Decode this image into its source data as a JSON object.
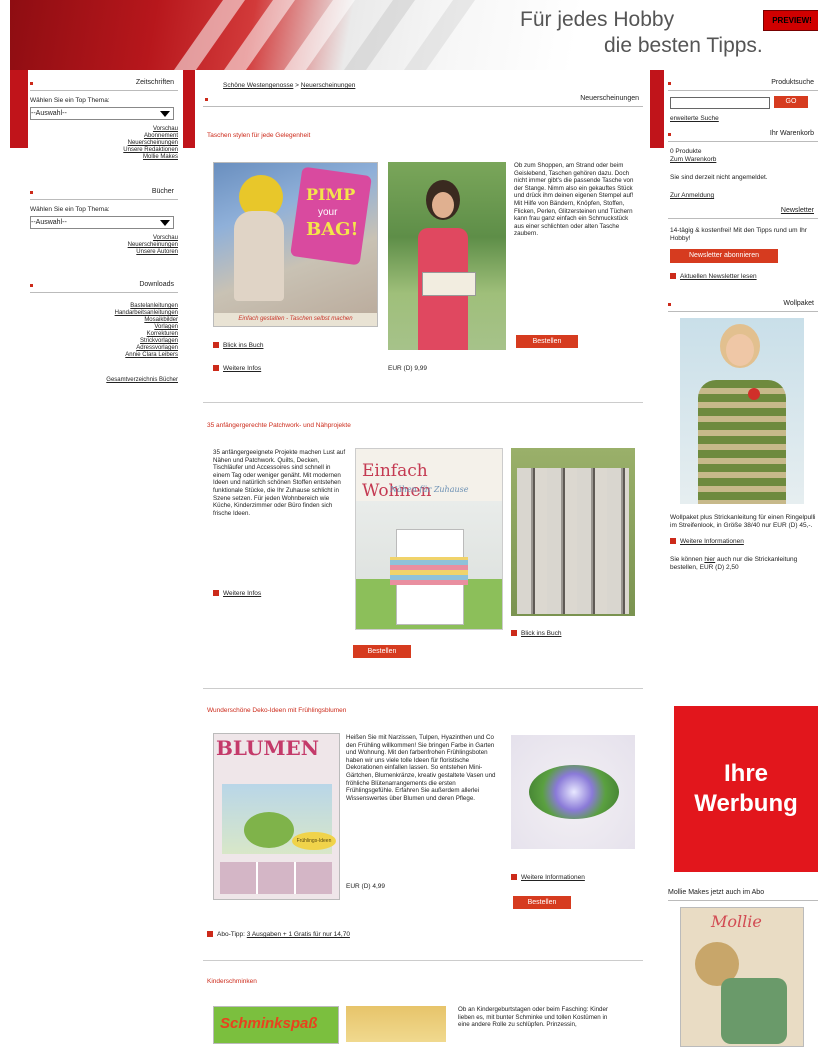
{
  "header": {
    "tagline_1": "Für jedes Hobby",
    "tagline_2": "die besten Tipps.",
    "preview_label": "PREVIEW!"
  },
  "left": {
    "zeitschriften": {
      "title": "Zeitschriften",
      "prompt": "Wählen Sie ein Top Thema:",
      "select_value": "--Auswahl--",
      "links": [
        "Vorschau",
        "Abonnement",
        "Neuerscheinungen",
        "Unsere Redaktionen",
        "Mollie Makes"
      ]
    },
    "buecher": {
      "title": "Bücher",
      "prompt": "Wählen Sie ein Top Thema:",
      "select_value": "--Auswahl--",
      "links": [
        "Vorschau",
        "Neuerscheinungen",
        "Unsere Autoren"
      ]
    },
    "downloads": {
      "title": "Downloads",
      "links": [
        "Bastelanleitungen",
        "Handarbeitsanleitungen",
        "Mosaikbilder",
        "Vorlagen",
        "Korrekturen",
        "Strickvorlagen",
        "Adressvorlagen",
        "Annie Clara Leibers"
      ],
      "extra": "Gesamtverzeichnis Bücher"
    }
  },
  "main": {
    "breadcrumb": [
      "Schöne Westengenosse",
      "Neuerscheinungen"
    ],
    "section_title": "Neuerscheinungen",
    "article1": {
      "headline": "Taschen stylen für jede Gelegenheit",
      "cover_text_1": "PIMP",
      "cover_text_2": "your",
      "cover_text_3": "BAG!",
      "cover_subtitle": "Einfach gestalten - Taschen selbst machen",
      "body": "Ob zum Shoppen, am Strand oder beim Geislebend, Taschen gehören dazu. Doch nicht immer gibt's die passende Tasche von der Stange. Nimm also ein gekauftes Stück und drück ihm deinen eigenen Stempel auf! Mit Hilfe von Bändern, Knöpfen, Stoffen, Flicken, Perlen, Glitzersteinen und Tüchern kann frau ganz einfach ein Schmuckstück aus einer schlichten oder alten Tasche zaubern.",
      "link_blick": "Blick ins Buch",
      "link_info": "Weitere Infos",
      "price": "EUR (D) 9,99",
      "button": "Bestellen"
    },
    "article2": {
      "headline": "35 anfängergerechte Patchwork- und Nähprojekte",
      "body": "35 anfängergeeignete Projekte machen Lust auf Nähen und Patchwork. Quilts, Decken, Tischläufer und Accessoires sind schnell in einem Tag oder weniger genäht. Mit modernen Ideen und natürlich schönen Stoffen entstehen funktionale Stücke, die Ihr Zuhause schlicht in Szene setzen. Für jeden Wohnbereich wie Küche, Kinderzimmer oder Büro finden sich frische Ideen.",
      "cover_title": "Einfach Wohnen",
      "cover_subtitle": "Nähen für Zuhause",
      "link_info": "Weitere Infos",
      "link_blick": "Blick ins Buch",
      "button": "Bestellen"
    },
    "article3": {
      "headline": "Wunderschöne Deko-Ideen mit Frühlingsblumen",
      "cover_title": "BLUMEN",
      "cover_badge": "Frühlings-Ideen",
      "body": "Heißen Sie mit Narzissen, Tulpen, Hyazinthen und Co den Frühling willkommen! Sie bringen Farbe in Garten und Wohnung. Mit den farbenfrohen Frühlingsboten haben wir uns viele tolle Ideen für floristische Dekorationen einfallen lassen. So entstehen Mini-Gärtchen, Blumenkränze, kreativ gestaltete Vasen und fröhliche Blütenarrangements die ersten Frühlingsgefühle. Erfahren Sie außerdem allerlei Wissenswertes über Blumen und deren Pflege.",
      "price": "EUR (D) 4,99",
      "link_info": "Weitere Informationen",
      "button": "Bestellen",
      "abo_label": "Abo-Tipp:",
      "abo_link": "3 Ausgaben + 1 Gratis für nur 14,70"
    },
    "article4": {
      "headline": "Kinderschminken",
      "cover_text": "Schminkspaß",
      "body": "Ob an Kindergeburtstagen oder beim Fasching: Kinder lieben es, mit bunter Schminke und tollen Kostümen in eine andere Rolle zu schlüpfen. Prinzessin,"
    }
  },
  "right": {
    "search": {
      "title": "Produktsuche",
      "placeholder": "",
      "go_label": "GO",
      "advanced_link": "erweiterte Suche"
    },
    "cart": {
      "title": "Ihr Warenkorb",
      "count": "0 Produkte",
      "link": "Zum Warenkorb",
      "status": "Sie sind derzeit nicht angemeldet.",
      "login_link": "Zur Anmeldung"
    },
    "newsletter": {
      "title": "Newsletter",
      "text": "14-tägig & kostenfrei! Mit den Tipps rund um Ihr Hobby!",
      "button": "Newsletter abonnieren",
      "link": "Aktuellen Newsletter lesen"
    },
    "wolle": {
      "title": "Wollpaket",
      "text": "Wollpaket plus Strickanleitung für einen Ringelpulli im Streifenlook, in Größe 38/40 nur EUR (D) 45,-.",
      "link": "Weitere Informationen",
      "text2a": "Sie können",
      "text2_link": "hier",
      "text2b": "auch nur die Strickanleitung bestellen, EUR (D) 2,50"
    },
    "ad": {
      "line1": "Ihre",
      "line2": "Werbung"
    },
    "mollie": {
      "title": "Mollie Makes jetzt auch im Abo",
      "cover_title": "Mollie"
    }
  },
  "colors": {
    "accent": "#cc2a1a",
    "header_red": "#b7171c",
    "button": "#d63b1f"
  }
}
